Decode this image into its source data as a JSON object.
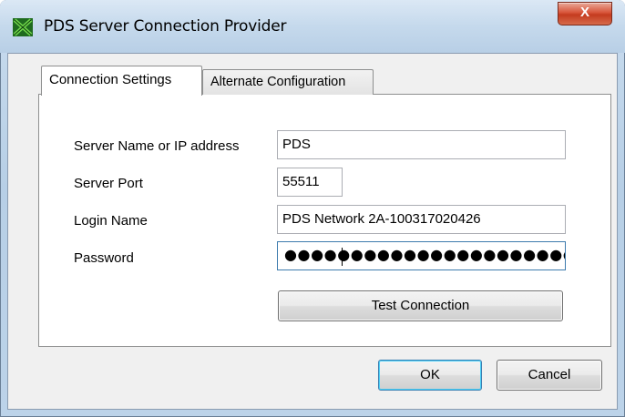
{
  "window": {
    "title": "PDS Server Connection Provider",
    "close_glyph": "X",
    "icon": "pds-app-icon"
  },
  "tabs": [
    {
      "label": "Connection Settings",
      "selected": true
    },
    {
      "label": "Alternate Configuration",
      "selected": false
    }
  ],
  "form": {
    "server_name": {
      "label": "Server Name or IP address",
      "value": "PDS"
    },
    "server_port": {
      "label": "Server Port",
      "value": "55511"
    },
    "login_name": {
      "label": "Login Name",
      "value": "PDS Network 2A-100317020426"
    },
    "password": {
      "label": "Password",
      "masked_value": "●●●●●●●●●●●●●●●●●●●●●●●●●●●●●●●●"
    }
  },
  "buttons": {
    "test_connection": "Test Connection",
    "ok": "OK",
    "cancel": "Cancel"
  },
  "colors": {
    "title_bar": "#c5d9ec",
    "close_button": "#c43b1f",
    "focus_border": "#3d7bad",
    "default_button_border": "#3c7fb1"
  }
}
